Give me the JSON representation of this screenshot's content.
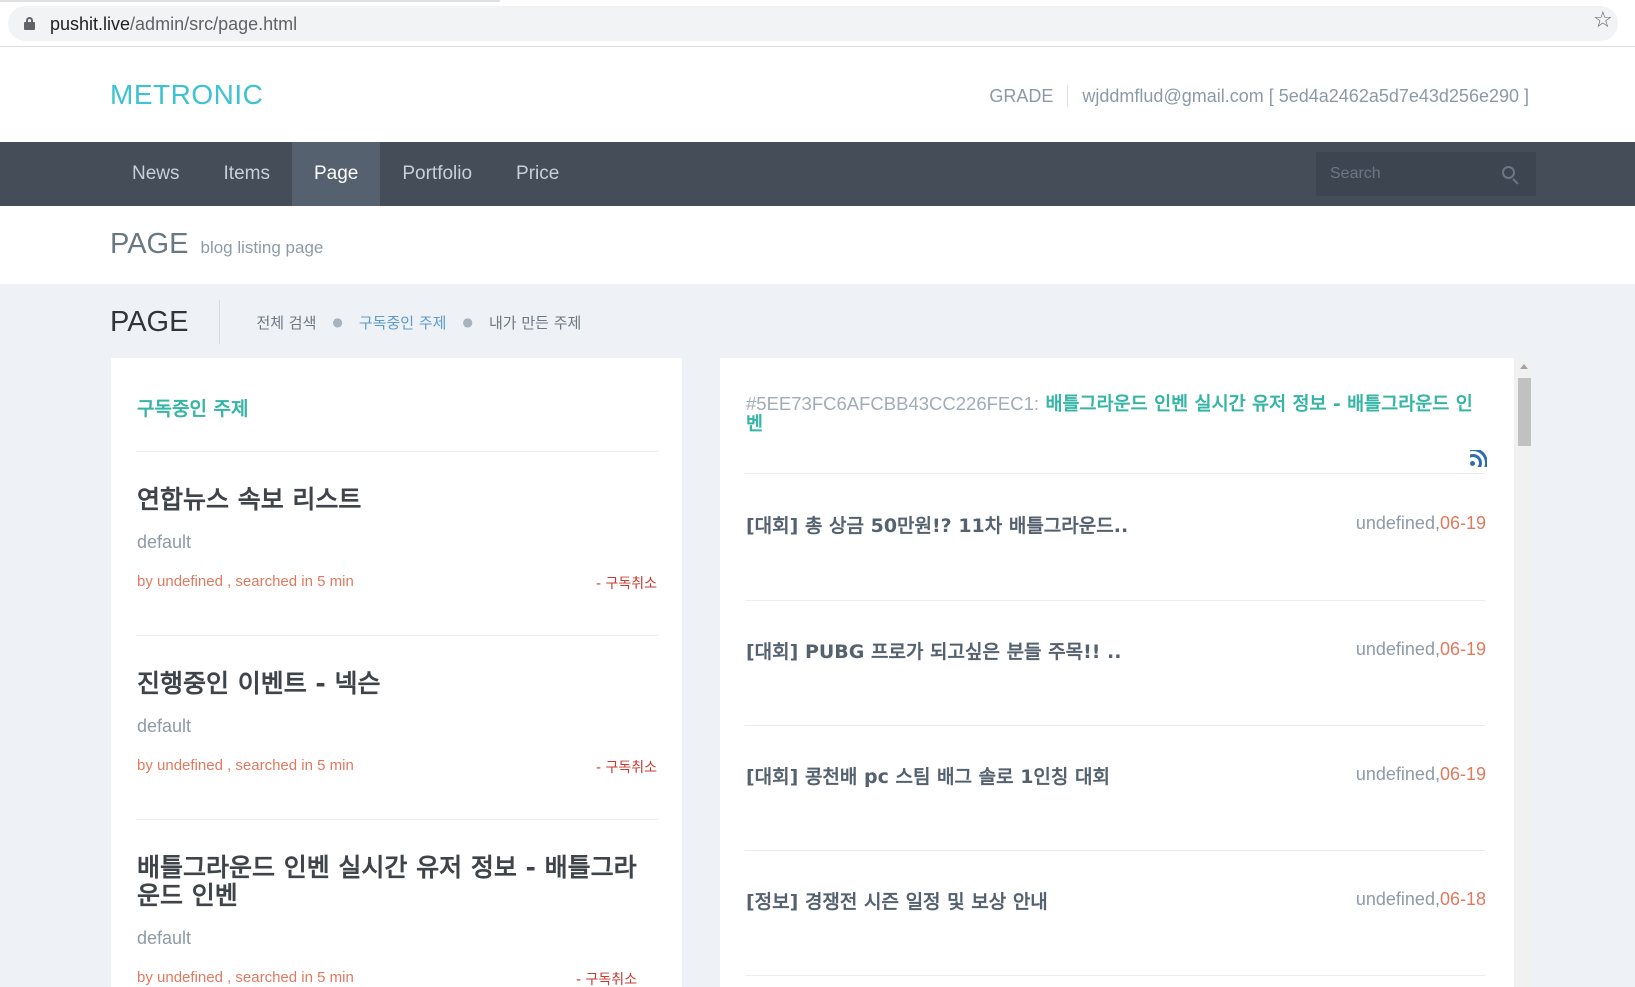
{
  "browser": {
    "url_host": "pushit.live",
    "url_path": "/admin/src/page.html",
    "icons": [
      "lock-icon",
      "star-icon"
    ]
  },
  "header": {
    "logo": "METRONIC",
    "grade": "GRADE",
    "user": "wjddmflud@gmail.com [ 5ed4a2462a5d7e43d256e290 ]"
  },
  "nav": {
    "items": [
      {
        "label": "News"
      },
      {
        "label": "Items"
      },
      {
        "label": "Page",
        "active": true
      },
      {
        "label": "Portfolio"
      },
      {
        "label": "Price"
      }
    ],
    "search_placeholder": "Search"
  },
  "page_head": {
    "title": "PAGE",
    "subtitle": "blog listing page"
  },
  "breadcrumb": {
    "title": "PAGE",
    "links": [
      "전체 검색",
      "구독중인 주제",
      "내가 만든 주제"
    ],
    "active_index": 1
  },
  "subscriptions": {
    "title": "구독중인 주제",
    "feeds": [
      {
        "title": "연합뉴스 속보 리스트",
        "desc": "default",
        "meta": "by undefined , searched in 5 min",
        "action": "- 구독취소"
      },
      {
        "title": "진행중인 이벤트 - 넥슨",
        "desc": "default",
        "meta": "by undefined , searched in 5 min",
        "action": "- 구독취소"
      },
      {
        "title": "배틀그라운드 인벤 실시간 유저 정보 - 배틀그라운드 인벤",
        "desc": "default",
        "meta": "by undefined , searched in 5 min",
        "action": "- 구독취소"
      }
    ]
  },
  "detail": {
    "hash": "#5EE73FC6AFCBB43CC226FEC1:",
    "title": "배틀그라운드 인벤 실시간 유저 정보 - 배틀그라운드 인벤",
    "articles": [
      {
        "title": "[대회]  총 상금 50만원!? 11차 배틀그라운드..",
        "author": "undefined,",
        "date": "06-19"
      },
      {
        "title": "[대회]  PUBG 프로가 되고싶은 분들 주목!! ..",
        "author": "undefined,",
        "date": "06-19"
      },
      {
        "title": "[대회]  콩천배 pc 스팀 배그 솔로 1인칭 대회",
        "author": "undefined,",
        "date": "06-19"
      },
      {
        "title": "[정보]  경쟁전 시즌 일정 및 보상 안내",
        "author": "undefined,",
        "date": "06-18"
      }
    ]
  },
  "colors": {
    "accent_teal": "#36b4a5",
    "logo": "#3cc2d2",
    "nav_bg": "#444d58",
    "date": "#e07a5f",
    "unsubscribe": "#c73a2e"
  }
}
